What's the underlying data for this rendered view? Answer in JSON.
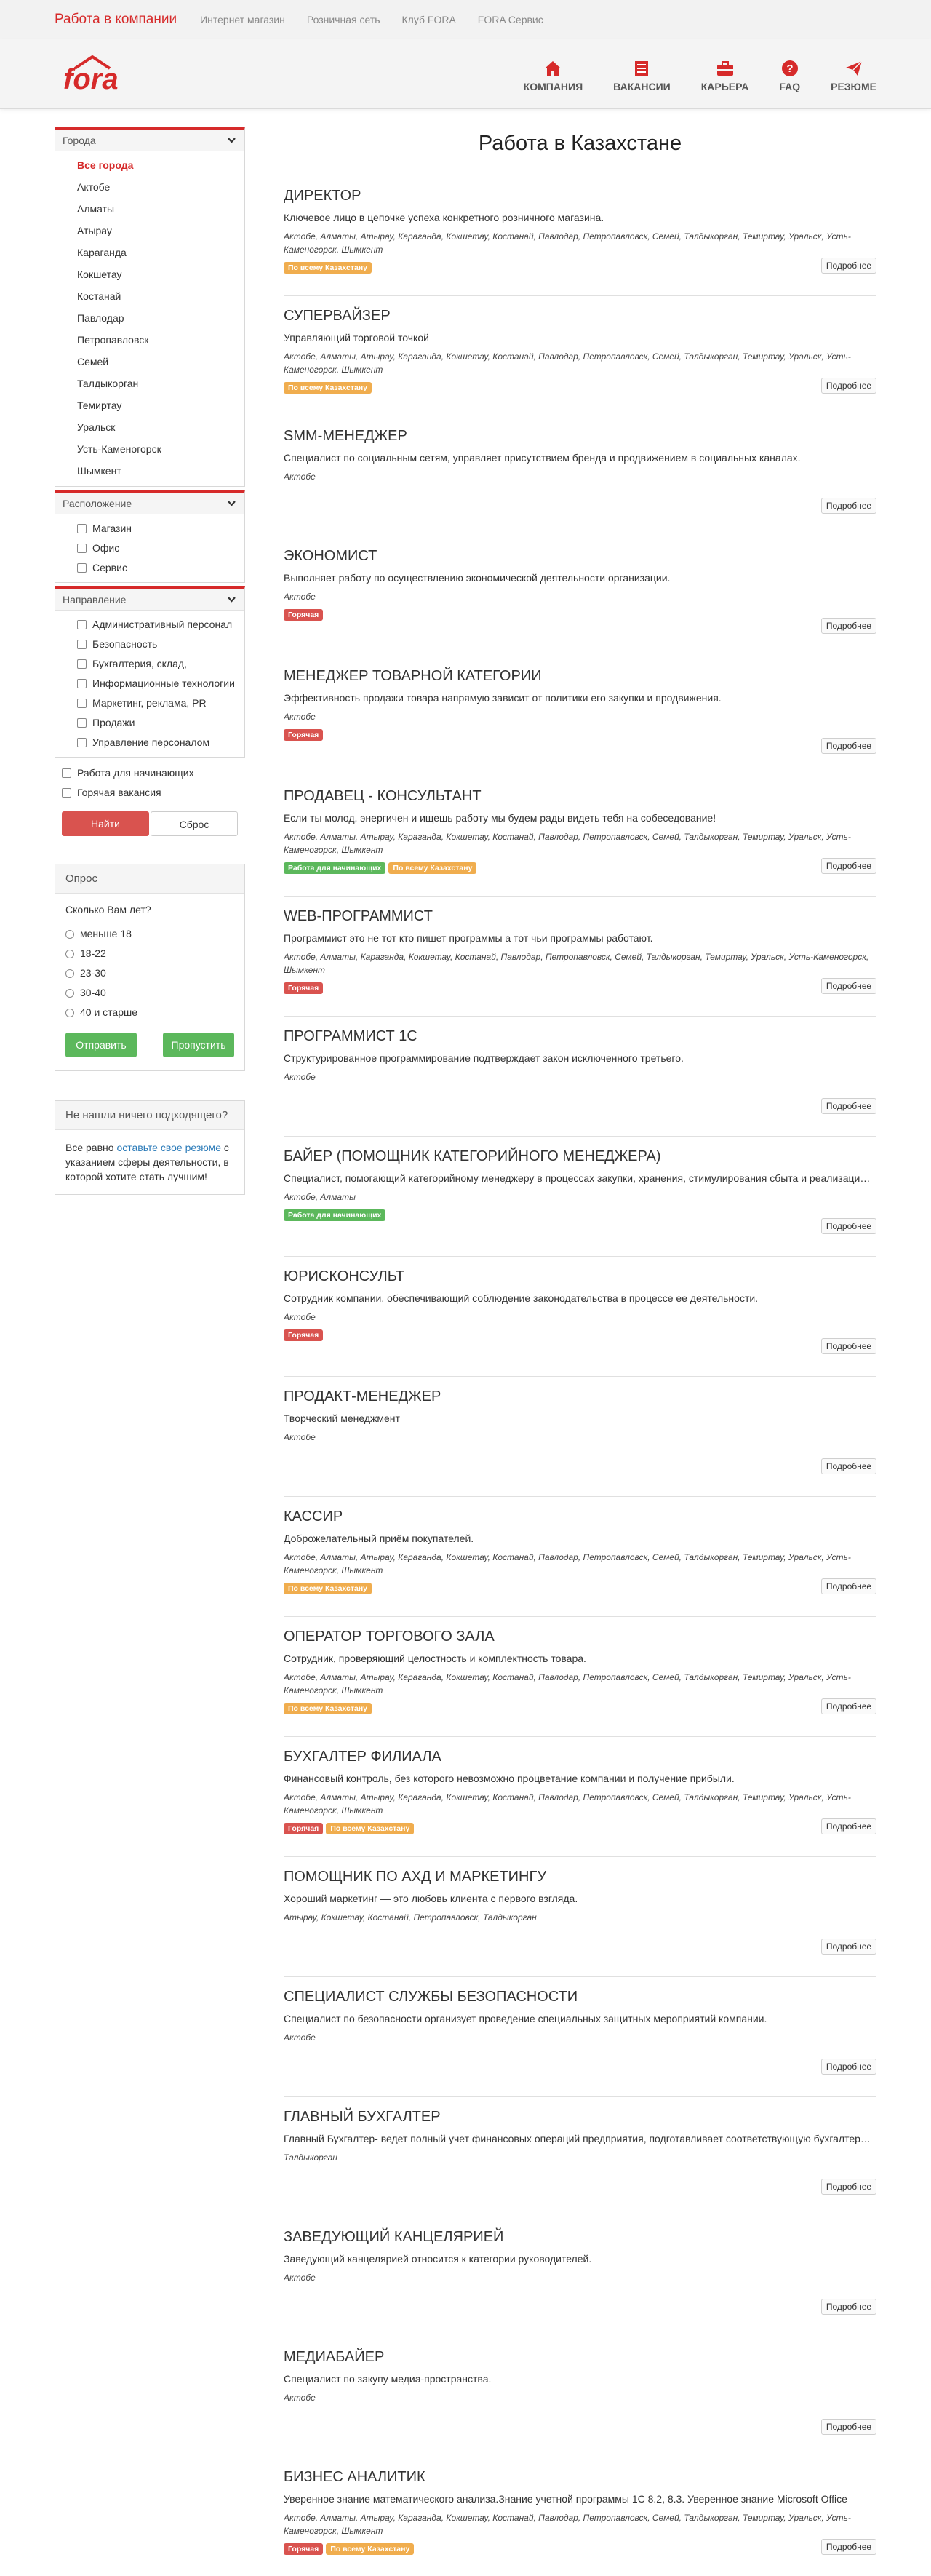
{
  "topbar": {
    "brand": "Работа в компании",
    "links": [
      "Интернет магазин",
      "Розничная сеть",
      "Клуб FORA",
      "FORA Сервис"
    ]
  },
  "logo": {
    "text": "fora",
    "color": "#d62a2a"
  },
  "mainnav": [
    {
      "label": "КОМПАНИЯ",
      "icon": "home-icon"
    },
    {
      "label": "ВАКАНСИИ",
      "icon": "list-icon"
    },
    {
      "label": "КАРЬЕРА",
      "icon": "briefcase-icon"
    },
    {
      "label": "FAQ",
      "icon": "question-icon"
    },
    {
      "label": "РЕЗЮМЕ",
      "icon": "send-icon"
    }
  ],
  "colors": {
    "accent": "#d62a2a",
    "hot": "#d9534f",
    "all_kz": "#f0ad4e",
    "beginners": "#5cb85c"
  },
  "filters": {
    "cities_title": "Города",
    "cities": [
      "Все города",
      "Актобе",
      "Алматы",
      "Атырау",
      "Караганда",
      "Кокшетау",
      "Костанай",
      "Павлодар",
      "Петропавловск",
      "Семей",
      "Талдыкорган",
      "Темиртау",
      "Уральск",
      "Усть-Каменогорск",
      "Шымкент"
    ],
    "location_title": "Расположение",
    "locations": [
      "Магазин",
      "Офис",
      "Сервис"
    ],
    "direction_title": "Направление",
    "directions": [
      "Административный персонал",
      "Безопасность",
      "Бухгалтерия, склад,",
      "Информационные технологии",
      "Маркетинг, реклама, PR",
      "Продажи",
      "Управление персоналом"
    ],
    "extra": [
      "Работа для начинающих",
      "Горячая вакансия"
    ],
    "find_button": "Найти",
    "reset_button": "Сброс"
  },
  "poll": {
    "title": "Опрос",
    "question": "Сколько Вам лет?",
    "options": [
      "меньше 18",
      "18-22",
      "23-30",
      "30-40",
      "40 и старше"
    ],
    "submit_button": "Отправить",
    "skip_button": "Пропустить"
  },
  "notfound": {
    "title": "Не нашли ничего подходящего?",
    "text_before": "Все равно ",
    "link": "оставьте свое резюме",
    "text_after": " с указанием сферы деятельности, в которой хотите стать лучшим!"
  },
  "page_title": "Работа в Казахстане",
  "more_label": "Подробнее",
  "jobs": [
    {
      "title": "ДИРЕКТОР",
      "desc": "Ключевое лицо в цепочке успеха конкретного розничного магазина.",
      "cities": "Актобе, Алматы, Атырау, Караганда, Кокшетау, Костанай, Павлодар, Петропавловск, Семей, Талдыкорган, Темиртау, Уральск, Усть-Каменогорск, Шымкент",
      "badges": [
        "По всему Казахстану"
      ]
    },
    {
      "title": "СУПЕРВАЙЗЕР",
      "desc": "Управляющий торговой точкой",
      "cities": "Актобе, Алматы, Атырау, Караганда, Кокшетау, Костанай, Павлодар, Петропавловск, Семей, Талдыкорган, Темиртау, Уральск, Усть-Каменогорск, Шымкент",
      "badges": [
        "По всему Казахстану"
      ]
    },
    {
      "title": "SMM-МЕНЕДЖЕР",
      "desc": "Специалист по социальным сетям, управляет присутствием бренда и продвижением в социальных каналах.",
      "cities": "Актобе",
      "badges": []
    },
    {
      "title": "ЭКОНОМИСТ",
      "desc": "Выполняет работу по осуществлению экономической деятельности организации.",
      "cities": "Актобе",
      "badges": [
        "Горячая"
      ]
    },
    {
      "title": "МЕНЕДЖЕР ТОВАРНОЙ КАТЕГОРИИ",
      "desc": "Эффективность продажи товара напрямую зависит от политики его закупки и продвижения.",
      "cities": "Актобе",
      "badges": [
        "Горячая"
      ]
    },
    {
      "title": "ПРОДАВЕЦ - КОНСУЛЬТАНТ",
      "desc": "Если ты молод, энергичен и ищешь работу мы будем рады видеть тебя на собеседование!",
      "cities": "Актобе, Алматы, Атырау, Караганда, Кокшетау, Костанай, Павлодар, Петропавловск, Семей, Талдыкорган, Темиртау, Уральск, Усть-Каменогорск, Шымкент",
      "badges": [
        "Работа для начинающих",
        "По всему Казахстану"
      ]
    },
    {
      "title": "WEB-ПРОГРАММИСТ",
      "desc": "Программист это не тот кто пишет программы а тот чьи программы работают.",
      "cities": "Актобе, Алматы, Караганда, Кокшетау, Костанай, Павлодар, Петропавловск, Семей, Талдыкорган, Темиртау, Уральск, Усть-Каменогорск, Шымкент",
      "badges": [
        "Горячая"
      ]
    },
    {
      "title": "ПРОГРАММИСТ 1С",
      "desc": "Структурированное программирование подтверждает закон исключенного третьего.",
      "cities": "Актобе",
      "badges": []
    },
    {
      "title": "БАЙЕР (ПОМОЩНИК КАТЕГОРИЙНОГО МЕНЕДЖЕРА)",
      "desc": "Специалист, помогающий категорийному менеджеру в процессах закупки, хранения, стимулирования сбыта и реализации товаров.",
      "cities": "Актобе, Алматы",
      "badges": [
        "Работа для начинающих"
      ]
    },
    {
      "title": "ЮРИСКОНСУЛЬТ",
      "desc": "Сотрудник компании, обеспечивающий соблюдение законодательства в процессе ее деятельности.",
      "cities": "Актобе",
      "badges": [
        "Горячая"
      ]
    },
    {
      "title": "ПРОДАКТ-МЕНЕДЖЕР",
      "desc": "Творческий менеджмент",
      "cities": "Актобе",
      "badges": []
    },
    {
      "title": "КАССИР",
      "desc": "Доброжелательный приём покупателей.",
      "cities": "Актобе, Алматы, Атырау, Караганда, Кокшетау, Костанай, Павлодар, Петропавловск, Семей, Талдыкорган, Темиртау, Уральск, Усть-Каменогорск, Шымкент",
      "badges": [
        "По всему Казахстану"
      ]
    },
    {
      "title": "ОПЕРАТОР ТОРГОВОГО ЗАЛА",
      "desc": "Сотрудник, проверяющий целостность и комплектность товара.",
      "cities": "Актобе, Алматы, Атырау, Караганда, Кокшетау, Костанай, Павлодар, Петропавловск, Семей, Талдыкорган, Темиртау, Уральск, Усть-Каменогорск, Шымкент",
      "badges": [
        "По всему Казахстану"
      ]
    },
    {
      "title": "БУХГАЛТЕР ФИЛИАЛА",
      "desc": "Финансовый контроль, без которого невозможно процветание компании и получение прибыли.",
      "cities": "Актобе, Алматы, Атырау, Караганда, Кокшетау, Костанай, Павлодар, Петропавловск, Семей, Талдыкорган, Темиртау, Уральск, Усть-Каменогорск, Шымкент",
      "badges": [
        "Горячая",
        "По всему Казахстану"
      ]
    },
    {
      "title": "ПОМОЩНИК ПО АХД И МАРКЕТИНГУ",
      "desc": "Хороший маркетинг — это любовь клиента с первого взгляда.",
      "cities": "Атырау, Кокшетау, Костанай, Петропавловск, Талдыкорган",
      "badges": []
    },
    {
      "title": "СПЕЦИАЛИСТ СЛУЖБЫ БЕЗОПАСНОСТИ",
      "desc": "Специалист по безопасности организует проведение специальных защитных мероприятий компании.",
      "cities": "Актобе",
      "badges": []
    },
    {
      "title": "ГЛАВНЫЙ БУХГАЛТЕР",
      "desc": "Главный Бухгалтер- ведет полный учет финансовых операций предприятия, подготавливает соответствующую бухгалтерскую отчетность.",
      "cities": "Талдыкорган",
      "badges": []
    },
    {
      "title": "ЗАВЕДУЮЩИЙ КАНЦЕЛЯРИЕЙ",
      "desc": "Заведующий канцелярией относится к категории руководителей.",
      "cities": "Актобе",
      "badges": []
    },
    {
      "title": "МЕДИАБАЙЕР",
      "desc": "Специалист по закупу медиа-пространства.",
      "cities": "Актобе",
      "badges": []
    },
    {
      "title": "БИЗНЕС АНАЛИТИК",
      "desc": "Уверенное знание математического анализа.Знание учетной программы 1С 8.2, 8.3. Уверенное знание Microsoft Office",
      "cities": "Актобе, Алматы, Атырау, Караганда, Кокшетау, Костанай, Павлодар, Петропавловск, Семей, Талдыкорган, Темиртау, Уральск, Усть-Каменогорск, Шымкент",
      "badges": [
        "Горячая",
        "По всему Казахстану"
      ]
    }
  ]
}
